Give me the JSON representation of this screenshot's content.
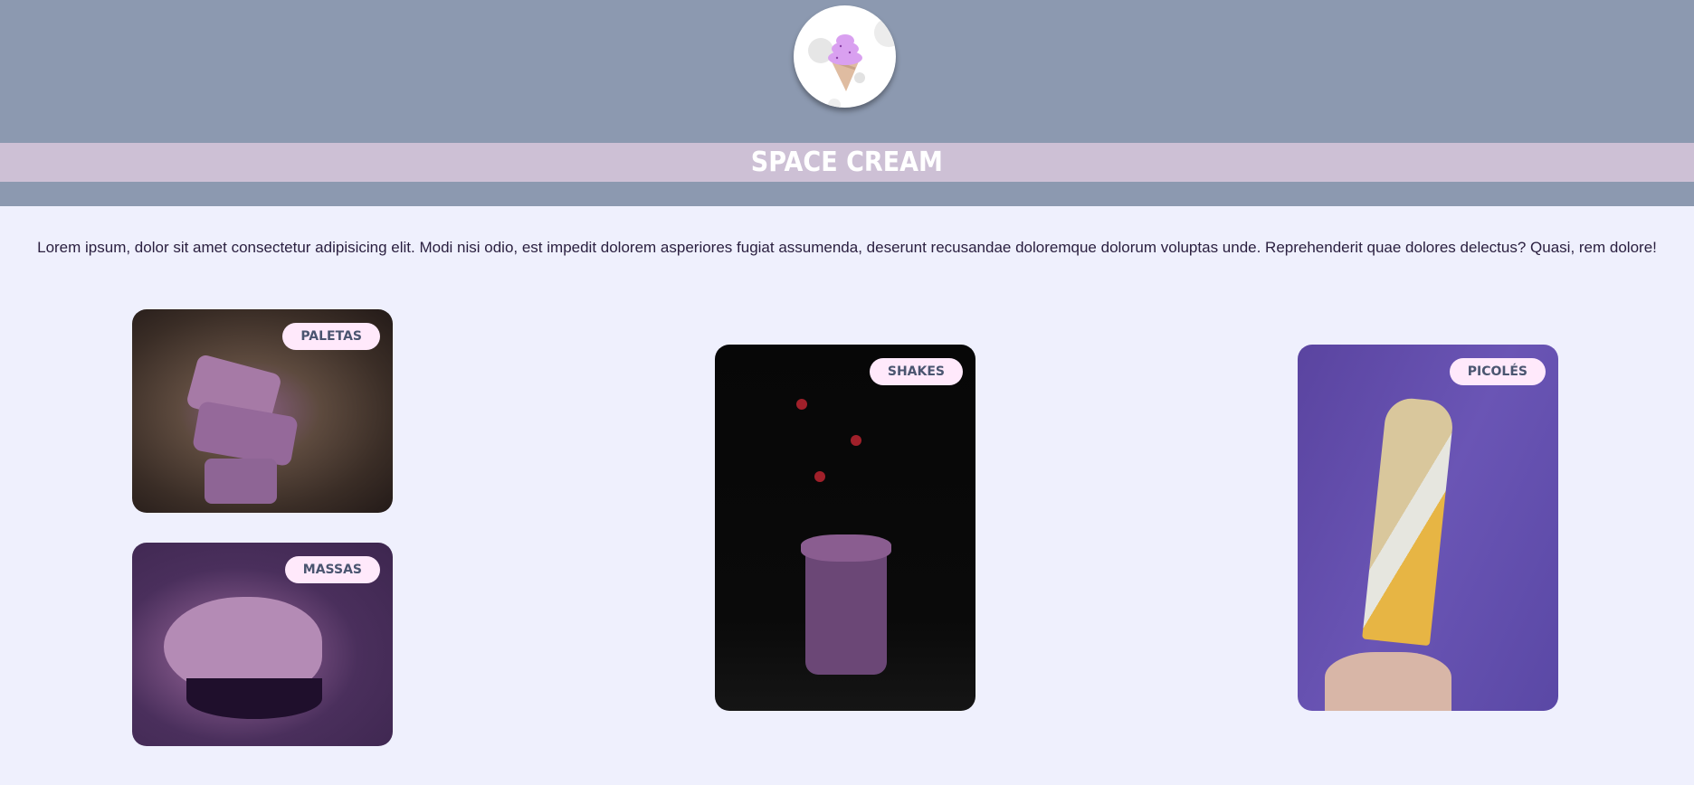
{
  "header": {
    "logo": "space-cream-ice-cream-logo",
    "title": "SPACE CREAM"
  },
  "intro": "Lorem ipsum, dolor sit amet consectetur adipisicing elit. Modi nisi odio, est impedit dolorem asperiores fugiat assumenda, deserunt recusandae doloremque dolorum voluptas unde. Reprehenderit quae dolores delectus? Quasi, rem dolore!",
  "cards": [
    {
      "label": "PALETAS"
    },
    {
      "label": "MASSAS"
    },
    {
      "label": "SHAKES"
    },
    {
      "label": "PICOLÉS"
    }
  ],
  "colors": {
    "header": "#8c99b0",
    "band": "#cdc0d5",
    "background": "#eff0fd",
    "badge": "#ffe9fb",
    "badge_text": "#4a5570"
  }
}
